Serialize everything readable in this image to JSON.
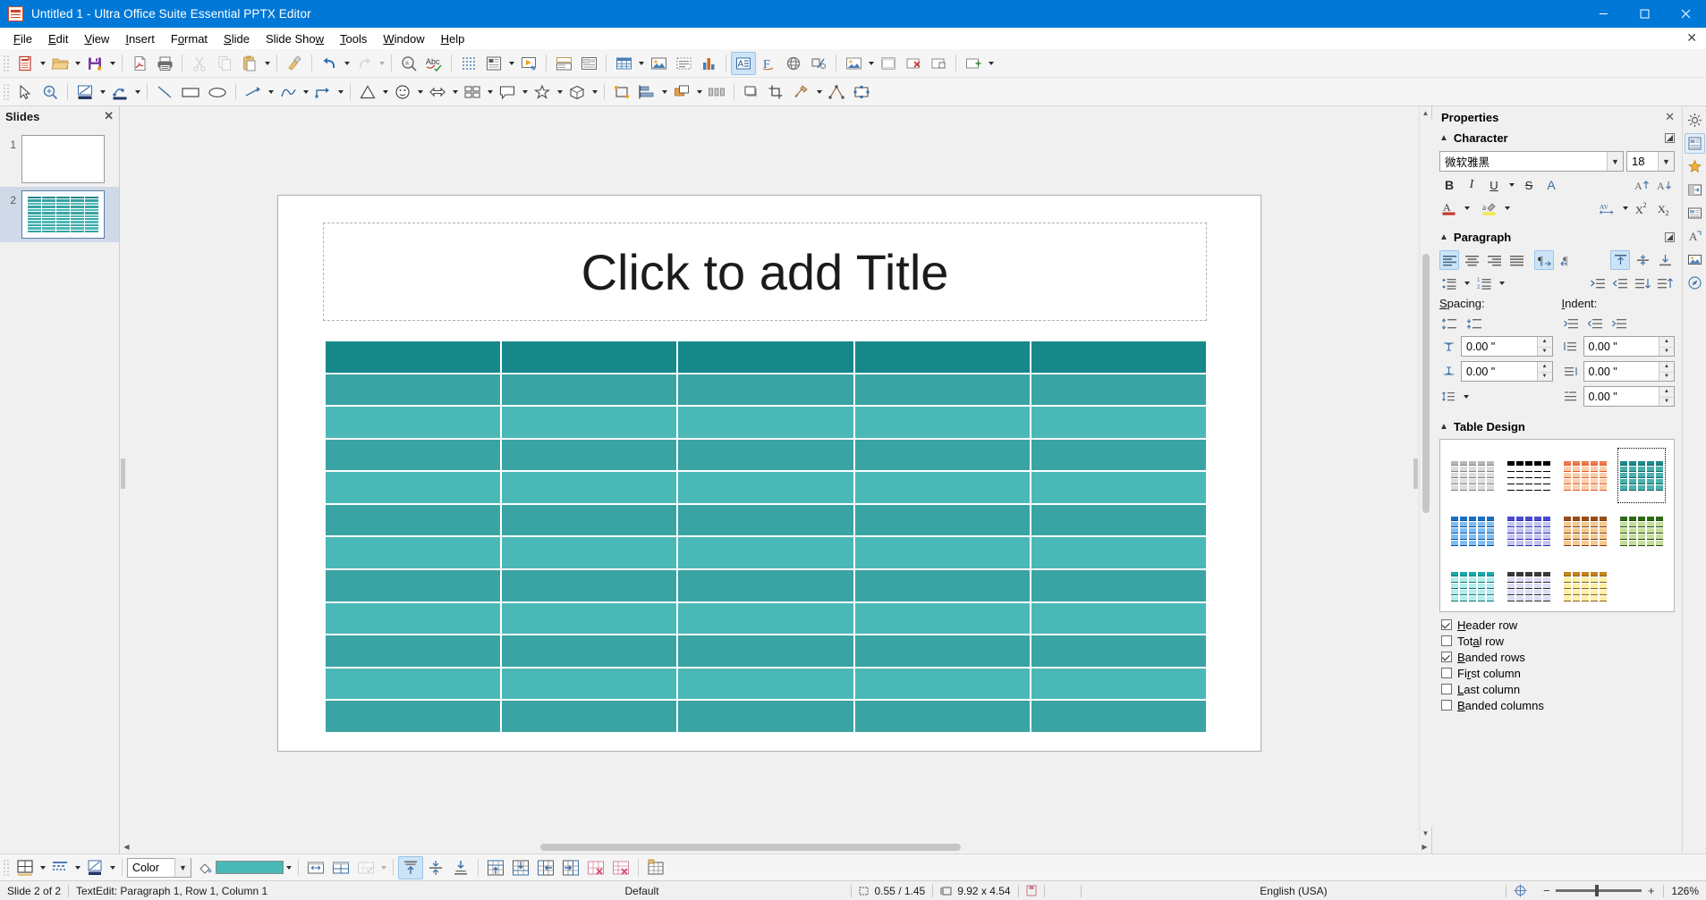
{
  "window": {
    "title": "Untitled 1 - Ultra Office Suite Essential PPTX Editor",
    "icon": "presentation-document-icon",
    "minimize": "─",
    "maximize": "☐",
    "close": "✕"
  },
  "menubar": {
    "items": [
      {
        "label": "File",
        "accel": "F"
      },
      {
        "label": "Edit",
        "accel": "E"
      },
      {
        "label": "View",
        "accel": "V"
      },
      {
        "label": "Insert",
        "accel": "I"
      },
      {
        "label": "Format",
        "accel": "o"
      },
      {
        "label": "Slide",
        "accel": "S"
      },
      {
        "label": "Slide Show",
        "accel": "S"
      },
      {
        "label": "Tools",
        "accel": "T"
      },
      {
        "label": "Window",
        "accel": "W"
      },
      {
        "label": "Help",
        "accel": "H"
      }
    ],
    "document_close": "✕"
  },
  "standard_toolbar": {
    "items": [
      "new-document-button",
      "new-document-dropdown",
      "open-file-button",
      "open-file-dropdown",
      "save-button",
      "save-dropdown",
      "export-pdf-button",
      "print-button",
      "cut-button",
      "copy-button",
      "paste-button",
      "paste-dropdown",
      "clone-formatting-button",
      "undo-button",
      "undo-dropdown",
      "redo-button",
      "redo-dropdown",
      "find-replace-button",
      "spelling-button",
      "display-grid-button",
      "master-slide-button",
      "master-slide-dropdown",
      "start-from-first-slide-button",
      "display-views-button",
      "outline-view-button",
      "insert-table-button",
      "insert-table-dropdown",
      "insert-image-button",
      "insert-textbox-button",
      "insert-chart-button",
      "insert-text-box-active-button",
      "fontwork-button",
      "hyperlink-button",
      "show-draw-functions-button",
      "insert-special-char-button",
      "insert-special-char-dropdown",
      "insert-header-footer-button",
      "delete-slide-button",
      "slide-properties-button",
      "new-slide-button",
      "new-slide-dropdown"
    ]
  },
  "drawing_toolbar": {
    "items": [
      "select-tool",
      "zoom-tool",
      "fill-color-button",
      "fill-color-dropdown",
      "line-color-button",
      "line-color-dropdown",
      "insert-line-tool",
      "rectangle-tool",
      "ellipse-tool",
      "lines-and-arrows-tool",
      "lines-and-arrows-dropdown",
      "curves-and-polygons-tool",
      "curves-dropdown",
      "connectors-tool",
      "connectors-dropdown",
      "basic-shapes-tool",
      "basic-shapes-dropdown",
      "symbol-shapes-tool",
      "symbol-shapes-dropdown",
      "block-arrows-tool",
      "block-arrows-dropdown",
      "flowchart-shapes-tool",
      "flowchart-dropdown",
      "callout-shapes-tool",
      "callout-dropdown",
      "stars-tool",
      "stars-dropdown",
      "3d-objects-tool",
      "3d-objects-dropdown",
      "rotate-tool",
      "align-objects-button",
      "align-dropdown",
      "arrange-button",
      "arrange-dropdown",
      "distribute-button",
      "shadow-button",
      "crop-button",
      "filter-button",
      "filter-dropdown",
      "points-button",
      "glue-points-button",
      "to-background-button"
    ]
  },
  "slides_panel": {
    "title": "Slides",
    "close": "✕",
    "slides": [
      {
        "number": "1",
        "selected": false,
        "has_table": false
      },
      {
        "number": "2",
        "selected": true,
        "has_table": true
      }
    ]
  },
  "slide": {
    "title_placeholder": "Click to add Title",
    "table": {
      "rows": 12,
      "columns": 5,
      "header_color": "#17888a",
      "band_a_color": "#3aa3a3",
      "band_b_color": "#4bb8b8",
      "gridline_color": "#ffffff"
    }
  },
  "properties": {
    "title": "Properties",
    "close": "✕",
    "character": {
      "heading": "Character",
      "font_name": "微软雅黑",
      "font_size": "18",
      "buttons": [
        {
          "name": "bold-button",
          "label": "B",
          "active": false
        },
        {
          "name": "italic-button",
          "label": "I",
          "active": false
        },
        {
          "name": "underline-button",
          "label": "U",
          "active": false
        },
        {
          "name": "strikethrough-button",
          "label": "S",
          "active": false
        },
        {
          "name": "shadow-button",
          "label": "A",
          "active": false
        },
        {
          "name": "increase-font-size-button",
          "label": "A",
          "active": false
        },
        {
          "name": "decrease-font-size-button",
          "label": "A",
          "active": false
        },
        {
          "name": "font-color-button",
          "label": "A",
          "active": false
        },
        {
          "name": "highlight-color-button",
          "label": "a",
          "active": false
        },
        {
          "name": "character-spacing-button",
          "label": "AV",
          "active": false
        },
        {
          "name": "superscript-button",
          "label": "X²",
          "active": false
        },
        {
          "name": "subscript-button",
          "label": "X₂",
          "active": false
        }
      ]
    },
    "paragraph": {
      "heading": "Paragraph",
      "align_left_active": true,
      "ltr_active": true,
      "align_top_active": true,
      "spacing_label": "Spacing:",
      "spacing_accel": "S",
      "indent_label": "Indent:",
      "indent_accel": "I",
      "spacing_above": "0.00 \"",
      "spacing_below": "0.00 \"",
      "indent_before": "0.00 \"",
      "indent_after": "0.00 \"",
      "indent_first_line": "0.00 \""
    },
    "table_design": {
      "heading": "Table Design",
      "styles": [
        {
          "name": "table-style-default",
          "selected": false,
          "dark": "#b8b8b8",
          "light": "#dcdcdc",
          "line": "#808080"
        },
        {
          "name": "table-style-black",
          "selected": false,
          "dark": "#000000",
          "light": "#ffffff",
          "line": "#000000"
        },
        {
          "name": "table-style-orange",
          "selected": false,
          "dark": "#f0794a",
          "light": "#fbcfae",
          "line": "#e05a24"
        },
        {
          "name": "table-style-teal",
          "selected": true,
          "dark": "#1b8a8a",
          "light": "#49b0ad",
          "line": "#0d5f5f"
        },
        {
          "name": "table-style-blue",
          "selected": false,
          "dark": "#1a6fc4",
          "light": "#7fbdf0",
          "line": "#0b4e92"
        },
        {
          "name": "table-style-periwinkle",
          "selected": false,
          "dark": "#4a4ad0",
          "light": "#c5c5f0",
          "line": "#2b2bb0"
        },
        {
          "name": "table-style-brown",
          "selected": false,
          "dark": "#9a4b18",
          "light": "#f5c98f",
          "line": "#7a3a10"
        },
        {
          "name": "table-style-green",
          "selected": false,
          "dark": "#2d6a14",
          "light": "#c5dd9a",
          "line": "#1d4a0a"
        },
        {
          "name": "table-style-cyan",
          "selected": false,
          "dark": "#1ba8a8",
          "light": "#b5ecec",
          "line": "#0e7575"
        },
        {
          "name": "table-style-lavender",
          "selected": false,
          "dark": "#3a3a3a",
          "light": "#dcdcf5",
          "line": "#2a2a2a"
        },
        {
          "name": "table-style-yellow",
          "selected": false,
          "dark": "#c4851a",
          "light": "#fcf0a8",
          "line": "#8a5c0a"
        }
      ]
    },
    "checkboxes": [
      {
        "name": "header-row-checkbox",
        "label": "Header row",
        "accel": "H",
        "checked": true
      },
      {
        "name": "total-row-checkbox",
        "label": "Total row",
        "accel": "a",
        "checked": false
      },
      {
        "name": "banded-rows-checkbox",
        "label": "Banded rows",
        "accel": "B",
        "checked": true
      },
      {
        "name": "first-column-checkbox",
        "label": "First column",
        "accel": "r",
        "checked": false
      },
      {
        "name": "last-column-checkbox",
        "label": "Last column",
        "accel": "L",
        "checked": false
      },
      {
        "name": "banded-columns-checkbox",
        "label": "Banded columns",
        "accel": "B",
        "checked": false
      }
    ]
  },
  "sidebar_tabs": [
    {
      "name": "sidebar-settings-icon",
      "selected": false
    },
    {
      "name": "sidebar-properties-icon",
      "selected": true
    },
    {
      "name": "sidebar-slide-transition-icon",
      "selected": false
    },
    {
      "name": "sidebar-animation-icon",
      "selected": false
    },
    {
      "name": "sidebar-master-slides-icon",
      "selected": false
    },
    {
      "name": "sidebar-styles-icon",
      "selected": false
    },
    {
      "name": "sidebar-gallery-icon",
      "selected": false
    },
    {
      "name": "sidebar-navigator-icon",
      "selected": false
    }
  ],
  "table_toolbar": {
    "border_style_label": "Color",
    "fill_color": "#4bb8b8",
    "items": [
      "table-borders-button",
      "table-borders-dropdown",
      "border-style-button",
      "border-style-dropdown",
      "border-color-button",
      "border-color-dropdown",
      "area-style-select",
      "fill-color-button",
      "fill-color-dropdown",
      "merge-cells-button",
      "split-cells-button",
      "optimize-button",
      "optimize-dropdown",
      "align-top-button",
      "center-vertically-button",
      "align-bottom-button",
      "insert-row-above-button",
      "insert-row-below-button",
      "insert-column-before-button",
      "insert-column-after-button",
      "delete-row-button",
      "delete-column-button",
      "table-properties-button"
    ]
  },
  "statusbar": {
    "slide_count": "Slide 2 of 2",
    "edit_status": "TextEdit: Paragraph 1, Row 1, Column 1",
    "master": "Default",
    "cursor_position": "0.55 / 1.45",
    "object_size": "9.92 x 4.54",
    "language": "English (USA)",
    "zoom": "126%",
    "zoom_minus": "−",
    "zoom_plus": "+"
  }
}
